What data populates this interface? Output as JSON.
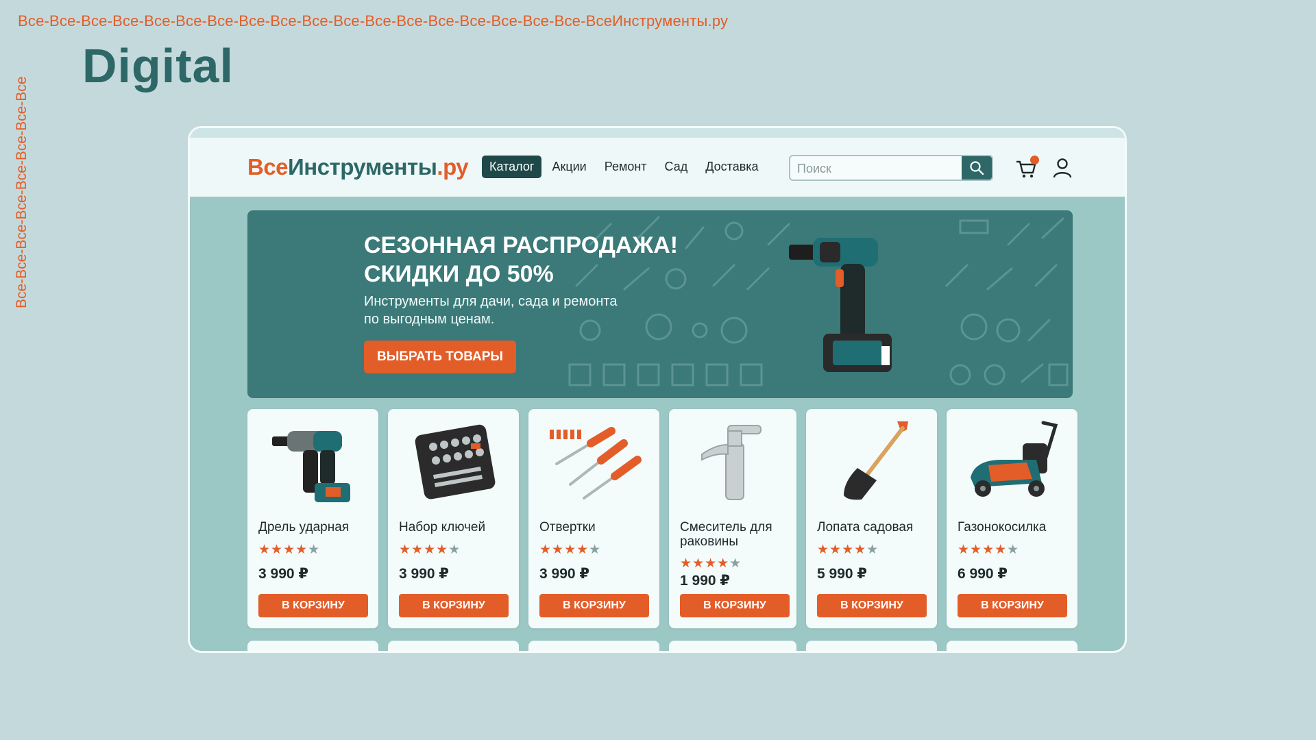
{
  "ticker_top": "Все-Все-Все-Все-Все-Все-Все-Все-Все-Все-Все-Все-Все-Все-Все-Все-Все-Все-ВсеИнструменты.ру",
  "ticker_side": "Все-Все-Все-Все-Все-Все-Все-Все",
  "headline": "Digital",
  "site": {
    "logo": {
      "part1": "Все",
      "part2": "Инструменты",
      "part3": ".ру"
    },
    "nav": [
      {
        "label": "Каталог",
        "active": true
      },
      {
        "label": "Акции"
      },
      {
        "label": "Ремонт"
      },
      {
        "label": "Сад"
      },
      {
        "label": "Доставка"
      }
    ],
    "search": {
      "placeholder": "Поиск",
      "value": ""
    },
    "cart_icon": "cart-icon",
    "user_icon": "user-icon"
  },
  "banner": {
    "title_line1": "СЕЗОННАЯ РАСПРОДАЖА!",
    "title_line2": "СКИДКИ ДО 50%",
    "subtitle_line1": "Инструменты для дачи, сада и ремонта",
    "subtitle_line2": "по выгодным ценам.",
    "button": "ВЫБРАТЬ ТОВАРЫ"
  },
  "products": [
    {
      "name": "Дрель ударная",
      "rating": 4.5,
      "price": "3 990 ₽",
      "button": "В КОРЗИНУ",
      "icon": "drill-icon"
    },
    {
      "name": "Набор ключей",
      "rating": 4.5,
      "price": "3 990 ₽",
      "button": "В КОРЗИНУ",
      "icon": "wrench-set-icon"
    },
    {
      "name": "Отвертки",
      "rating": 4,
      "price": "3 990 ₽",
      "button": "В КОРЗИНУ",
      "icon": "screwdrivers-icon"
    },
    {
      "name": "Смеситель для раковины",
      "rating": 4.5,
      "price": "1 990 ₽",
      "button": "В КОРЗИНУ",
      "icon": "faucet-icon"
    },
    {
      "name": "Лопата садовая",
      "rating": 4.5,
      "price": "5 990 ₽",
      "button": "В КОРЗИНУ",
      "icon": "shovel-icon"
    },
    {
      "name": "Газонокосилка",
      "rating": 4.5,
      "price": "6 990 ₽",
      "button": "В КОРЗИНУ",
      "icon": "lawnmower-icon"
    }
  ],
  "colors": {
    "accent": "#e35d28",
    "brand": "#2d6767",
    "background": "#c4d9db"
  }
}
